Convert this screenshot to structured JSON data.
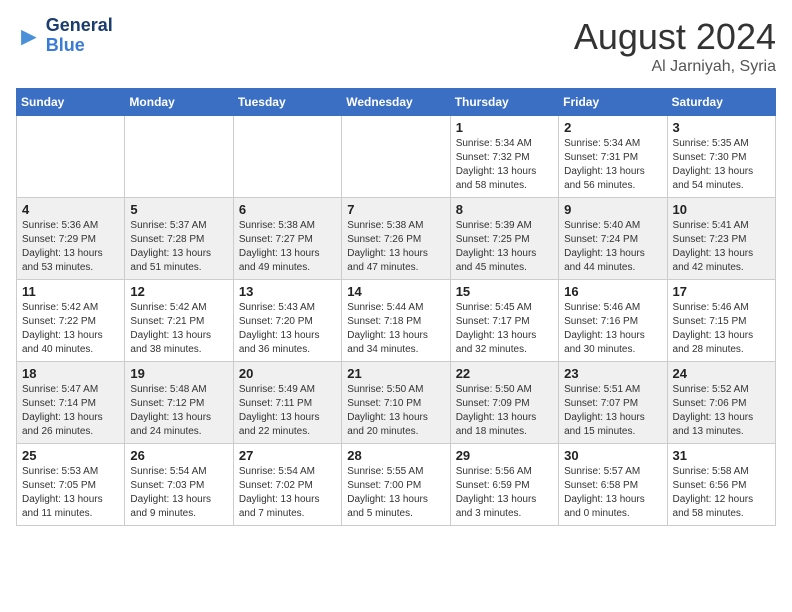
{
  "header": {
    "logo_general": "General",
    "logo_blue": "Blue",
    "month_year": "August 2024",
    "location": "Al Jarniyah, Syria"
  },
  "days_of_week": [
    "Sunday",
    "Monday",
    "Tuesday",
    "Wednesday",
    "Thursday",
    "Friday",
    "Saturday"
  ],
  "weeks": [
    [
      {
        "day": "",
        "info": ""
      },
      {
        "day": "",
        "info": ""
      },
      {
        "day": "",
        "info": ""
      },
      {
        "day": "",
        "info": ""
      },
      {
        "day": "1",
        "info": "Sunrise: 5:34 AM\nSunset: 7:32 PM\nDaylight: 13 hours\nand 58 minutes."
      },
      {
        "day": "2",
        "info": "Sunrise: 5:34 AM\nSunset: 7:31 PM\nDaylight: 13 hours\nand 56 minutes."
      },
      {
        "day": "3",
        "info": "Sunrise: 5:35 AM\nSunset: 7:30 PM\nDaylight: 13 hours\nand 54 minutes."
      }
    ],
    [
      {
        "day": "4",
        "info": "Sunrise: 5:36 AM\nSunset: 7:29 PM\nDaylight: 13 hours\nand 53 minutes."
      },
      {
        "day": "5",
        "info": "Sunrise: 5:37 AM\nSunset: 7:28 PM\nDaylight: 13 hours\nand 51 minutes."
      },
      {
        "day": "6",
        "info": "Sunrise: 5:38 AM\nSunset: 7:27 PM\nDaylight: 13 hours\nand 49 minutes."
      },
      {
        "day": "7",
        "info": "Sunrise: 5:38 AM\nSunset: 7:26 PM\nDaylight: 13 hours\nand 47 minutes."
      },
      {
        "day": "8",
        "info": "Sunrise: 5:39 AM\nSunset: 7:25 PM\nDaylight: 13 hours\nand 45 minutes."
      },
      {
        "day": "9",
        "info": "Sunrise: 5:40 AM\nSunset: 7:24 PM\nDaylight: 13 hours\nand 44 minutes."
      },
      {
        "day": "10",
        "info": "Sunrise: 5:41 AM\nSunset: 7:23 PM\nDaylight: 13 hours\nand 42 minutes."
      }
    ],
    [
      {
        "day": "11",
        "info": "Sunrise: 5:42 AM\nSunset: 7:22 PM\nDaylight: 13 hours\nand 40 minutes."
      },
      {
        "day": "12",
        "info": "Sunrise: 5:42 AM\nSunset: 7:21 PM\nDaylight: 13 hours\nand 38 minutes."
      },
      {
        "day": "13",
        "info": "Sunrise: 5:43 AM\nSunset: 7:20 PM\nDaylight: 13 hours\nand 36 minutes."
      },
      {
        "day": "14",
        "info": "Sunrise: 5:44 AM\nSunset: 7:18 PM\nDaylight: 13 hours\nand 34 minutes."
      },
      {
        "day": "15",
        "info": "Sunrise: 5:45 AM\nSunset: 7:17 PM\nDaylight: 13 hours\nand 32 minutes."
      },
      {
        "day": "16",
        "info": "Sunrise: 5:46 AM\nSunset: 7:16 PM\nDaylight: 13 hours\nand 30 minutes."
      },
      {
        "day": "17",
        "info": "Sunrise: 5:46 AM\nSunset: 7:15 PM\nDaylight: 13 hours\nand 28 minutes."
      }
    ],
    [
      {
        "day": "18",
        "info": "Sunrise: 5:47 AM\nSunset: 7:14 PM\nDaylight: 13 hours\nand 26 minutes."
      },
      {
        "day": "19",
        "info": "Sunrise: 5:48 AM\nSunset: 7:12 PM\nDaylight: 13 hours\nand 24 minutes."
      },
      {
        "day": "20",
        "info": "Sunrise: 5:49 AM\nSunset: 7:11 PM\nDaylight: 13 hours\nand 22 minutes."
      },
      {
        "day": "21",
        "info": "Sunrise: 5:50 AM\nSunset: 7:10 PM\nDaylight: 13 hours\nand 20 minutes."
      },
      {
        "day": "22",
        "info": "Sunrise: 5:50 AM\nSunset: 7:09 PM\nDaylight: 13 hours\nand 18 minutes."
      },
      {
        "day": "23",
        "info": "Sunrise: 5:51 AM\nSunset: 7:07 PM\nDaylight: 13 hours\nand 15 minutes."
      },
      {
        "day": "24",
        "info": "Sunrise: 5:52 AM\nSunset: 7:06 PM\nDaylight: 13 hours\nand 13 minutes."
      }
    ],
    [
      {
        "day": "25",
        "info": "Sunrise: 5:53 AM\nSunset: 7:05 PM\nDaylight: 13 hours\nand 11 minutes."
      },
      {
        "day": "26",
        "info": "Sunrise: 5:54 AM\nSunset: 7:03 PM\nDaylight: 13 hours\nand 9 minutes."
      },
      {
        "day": "27",
        "info": "Sunrise: 5:54 AM\nSunset: 7:02 PM\nDaylight: 13 hours\nand 7 minutes."
      },
      {
        "day": "28",
        "info": "Sunrise: 5:55 AM\nSunset: 7:00 PM\nDaylight: 13 hours\nand 5 minutes."
      },
      {
        "day": "29",
        "info": "Sunrise: 5:56 AM\nSunset: 6:59 PM\nDaylight: 13 hours\nand 3 minutes."
      },
      {
        "day": "30",
        "info": "Sunrise: 5:57 AM\nSunset: 6:58 PM\nDaylight: 13 hours\nand 0 minutes."
      },
      {
        "day": "31",
        "info": "Sunrise: 5:58 AM\nSunset: 6:56 PM\nDaylight: 12 hours\nand 58 minutes."
      }
    ]
  ]
}
